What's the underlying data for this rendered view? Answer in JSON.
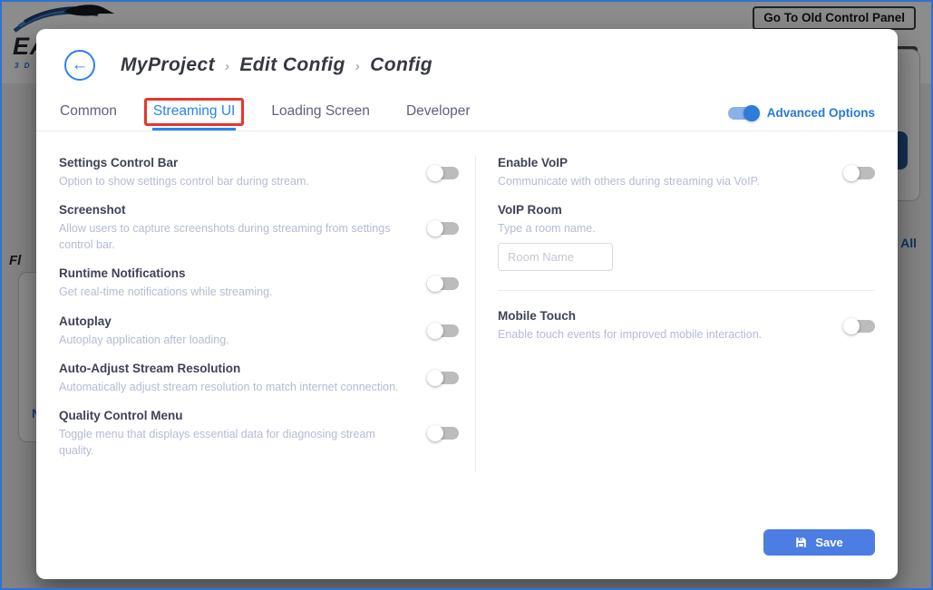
{
  "header": {
    "logo_text_partial": "EA",
    "logo_subtext_partial": "3 D",
    "old_panel_button_label": "Go To Old Control Panel"
  },
  "background_page": {
    "left_section_title_partial": "Fl",
    "left_card_link_partial": "N",
    "right_link_partial": "All"
  },
  "modal": {
    "breadcrumb": {
      "items": [
        "MyProject",
        "Edit Config",
        "Config"
      ],
      "separator": "›"
    },
    "tabs": [
      {
        "label": "Common"
      },
      {
        "label": "Streaming UI"
      },
      {
        "label": "Loading Screen"
      },
      {
        "label": "Developer"
      }
    ],
    "active_tab": "Streaming UI",
    "advanced_options": {
      "label": "Advanced Options",
      "state": "on"
    },
    "left_settings": [
      {
        "title": "Settings Control Bar",
        "description": "Option to show settings control bar during stream.",
        "state": "off"
      },
      {
        "title": "Screenshot",
        "description": "Allow users to capture screenshots during streaming from settings control bar.",
        "state": "off"
      },
      {
        "title": "Runtime Notifications",
        "description": "Get real-time notifications while streaming.",
        "state": "off"
      },
      {
        "title": "Autoplay",
        "description": "Autoplay application after loading.",
        "state": "off"
      },
      {
        "title": "Auto-Adjust Stream Resolution",
        "description": "Automatically adjust stream resolution to match internet connection.",
        "state": "off"
      },
      {
        "title": "Quality Control Menu",
        "description": "Toggle menu that displays essential data for diagnosing stream quality.",
        "state": "off"
      }
    ],
    "right_settings": {
      "enable_voip": {
        "title": "Enable VoIP",
        "description": "Communicate with others during streaming via VoIP.",
        "state": "off"
      },
      "voip_room": {
        "title": "VoIP Room",
        "description": "Type a room name.",
        "placeholder": "Room Name",
        "value": ""
      },
      "mobile_touch": {
        "title": "Mobile Touch",
        "description": "Enable touch events for improved mobile interaction.",
        "state": "off"
      }
    },
    "save_button_label": "Save",
    "back_icon_glyph": "←"
  },
  "colors": {
    "accent_blue": "#2884ef",
    "save_blue": "#4b7de2",
    "annotation_red": "#e8352e",
    "title_text": "#3f4254",
    "muted_text": "#b5bad4",
    "frame_border_blue": "#2f72d2"
  }
}
